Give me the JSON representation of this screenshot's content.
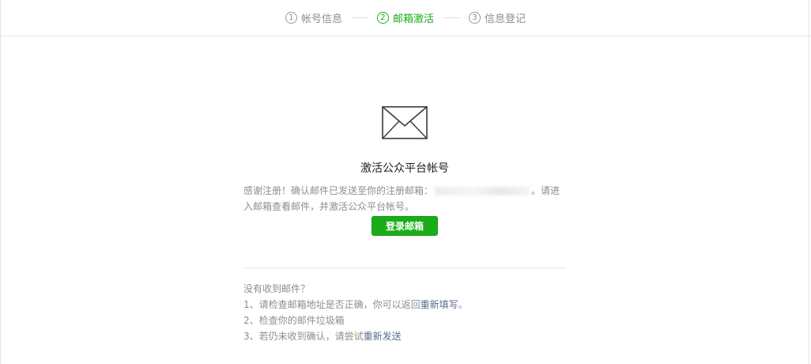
{
  "steps": [
    {
      "num": "1",
      "label": "帐号信息",
      "active": false
    },
    {
      "num": "2",
      "label": "邮箱激活",
      "active": true
    },
    {
      "num": "3",
      "label": "信息登记",
      "active": false
    }
  ],
  "colors": {
    "accent": "#1aad19",
    "link": "#576b95",
    "muted": "#8d8d8d"
  },
  "main": {
    "icon": "envelope-icon",
    "title": "激活公众平台帐号",
    "desc_before": "感谢注册！确认邮件已发送至你的注册邮箱：",
    "desc_after": "。请进入邮箱查看邮件，并激活公众平台帐号。",
    "login_button": "登录邮箱"
  },
  "help": {
    "heading": "没有收到邮件？",
    "item1_text": "1、请检查邮箱地址是否正确，你可以返回",
    "item1_link": "重新填写",
    "item1_end": "。",
    "item2_text": "2、检查你的邮件垃圾箱",
    "item3_text": "3、若仍未收到确认，请尝试",
    "item3_link": "重新发送"
  }
}
